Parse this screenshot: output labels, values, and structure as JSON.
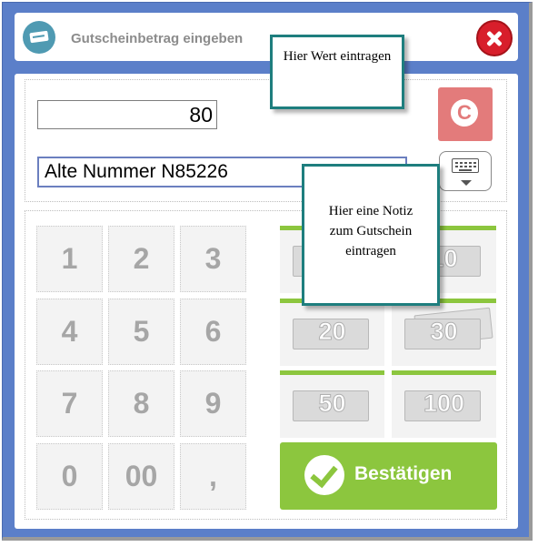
{
  "window": {
    "title": "Gutscheinbetrag eingeben",
    "icon": "voucher-icon",
    "close_icon": "close-icon"
  },
  "inputs": {
    "amount_value": "80",
    "note_value": "Alte Nummer N85226",
    "clear_label": "C"
  },
  "keypad": {
    "keys": [
      "1",
      "2",
      "3",
      "4",
      "5",
      "6",
      "7",
      "8",
      "9",
      "0",
      "00",
      ","
    ]
  },
  "quick_amounts": [
    {
      "value": "10",
      "type": "banknote"
    },
    {
      "value": "10",
      "type": "banknote"
    },
    {
      "value": "20",
      "type": "banknote"
    },
    {
      "value": "30",
      "type": "banknote"
    },
    {
      "value": "50",
      "type": "banknote"
    },
    {
      "value": "100",
      "type": "banknote"
    }
  ],
  "confirm": {
    "label": "Bestätigen"
  },
  "callouts": {
    "value_hint": "Hier Wert eintragen",
    "note_hint": "Hier eine Notiz zum Gutschein eintragen"
  },
  "colors": {
    "frame": "#5b7fc9",
    "close": "#d81e2b",
    "clear": "#e37b7b",
    "confirm": "#8cc63e",
    "callout_border": "#1e7e7e"
  }
}
